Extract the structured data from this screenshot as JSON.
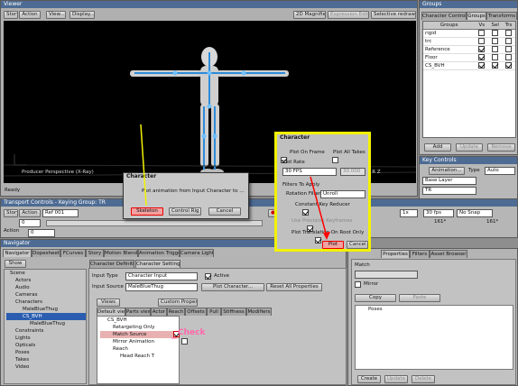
{
  "viewer": {
    "title": "Viewer",
    "story_btn": "Story",
    "action_btn": "Action",
    "view_btn": "View...",
    "display_btn": "Display...",
    "zd_btn": "2D Magnifier",
    "expression_btn": "Expression Editor",
    "selective_btn": "Selective redraw",
    "perspective": "Producer Perspective (X-Ray)",
    "status": "Ready",
    "coords": "LX:M Y R Z"
  },
  "groups": {
    "title": "Groups",
    "tabs": [
      "Character Controls",
      "Groups",
      "Transforms"
    ],
    "col_groups": "Groups",
    "col_vs": "Vs",
    "col_sel": "Sel",
    "col_trs": "Trs",
    "rows": [
      {
        "name": "rigid",
        "vs": false,
        "sel": false,
        "trs": false
      },
      {
        "name": "trc",
        "vs": false,
        "sel": false,
        "trs": false
      },
      {
        "name": "Reference",
        "vs": true,
        "sel": false,
        "trs": false
      },
      {
        "name": "Floor",
        "vs": true,
        "sel": false,
        "trs": false
      },
      {
        "name": "CS_BVH",
        "vs": true,
        "sel": true,
        "trs": true
      }
    ],
    "add_btn": "Add",
    "update_btn": "Update",
    "remove_btn": "Remove"
  },
  "keycontrols": {
    "title": "Key Controls",
    "animation_btn": "Animation...",
    "type_label": "Type",
    "type_value": "Auto",
    "base_layer": "Base Layer",
    "tr_label": "TR"
  },
  "transport": {
    "title": "Transport Controls - Keying Group: TR",
    "story_btn": "Story",
    "action_btn": "Action",
    "ref": "Ref 001",
    "frame_start": "0",
    "frame_end": "0",
    "fps": "30 fps",
    "snap": "No Snap",
    "frame_a": "161*",
    "frame_b": "161*"
  },
  "navigator": {
    "title": "Navigator",
    "tabs": [
      "Navigator",
      "Dopesheet",
      "FCurves",
      "Story",
      "Motion Blend",
      "Animation Trigger",
      "Camera Lights"
    ],
    "show_btn": "Show",
    "tree": [
      "Scene",
      "Actors",
      "Audio",
      "Cameras",
      "Characters",
      "MaleBlueThug",
      "CS_BVH",
      "MaleBlueThug",
      "Constraints",
      "Lights",
      "Opticals",
      "Poses",
      "Takes",
      "Video"
    ]
  },
  "charsettings": {
    "tabs": [
      "Character Definition",
      "Character Settings"
    ],
    "input_type_label": "Input Type",
    "input_type_value": "Character Input",
    "active_label": "Active",
    "input_source_label": "Input Source",
    "input_source_value": "MaleBlueThug",
    "plot_character_btn": "Plot Character...",
    "reset_btn": "Reset All Properties",
    "views_btn": "Views",
    "custom_btn": "Custom Properties",
    "subtabs": [
      "Default view",
      "Parts view",
      "Actor",
      "Reach",
      "Offsets",
      "Pull",
      "Stiffness",
      "Modifiers"
    ],
    "props": [
      "CS_BVH",
      "Retargeting Only",
      "Match Source",
      "Mirror Animation",
      "Reach",
      "Head Reach T"
    ],
    "check_annotation": "Check"
  },
  "right_panel": {
    "tabs": [
      "Properties",
      "Filters",
      "Asset Browser"
    ],
    "match_label": "Match",
    "mirror_label": "Mirror",
    "copy_btn": "Copy",
    "paste_btn": "Paste",
    "poses_item": "Poses",
    "create_btn": "Create",
    "update_btn": "Update",
    "delete_btn": "Delete"
  },
  "char_dialog": {
    "title": "Character",
    "message": "Plot animation from Input Character to ...",
    "skeleton_btn": "Skeleton",
    "control_rig_btn": "Control Rig",
    "cancel_btn": "Cancel"
  },
  "plot_dialog": {
    "title": "Character",
    "plot_on_frame": "Plot On Frame",
    "plot_all_takes": "Plot All Takes",
    "plot_rate_label": "Plot Rate",
    "plot_rate_value": "30 FPS",
    "plot_rate_num": "30.000",
    "filters_label": "Filters To Apply",
    "rotation_filter_label": "Rotation Filter :",
    "rotation_filter_value": "Unroll",
    "constant_key": "Constant Key Reducer",
    "precision_label": "Use Precision Keyframes",
    "plot_translation": "Plot Translation On Root Only",
    "plot_btn": "Plot",
    "cancel_btn": "Cancel"
  },
  "colors": {
    "title_bar": "#4d6b93",
    "highlight": "#ffff00",
    "arrow": "#ff0000",
    "annotation": "#ff66aa"
  }
}
